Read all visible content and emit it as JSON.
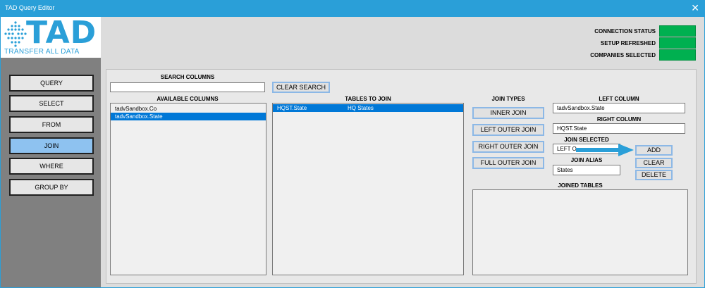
{
  "window": {
    "title": "TAD Query Editor",
    "close_glyph": "✕"
  },
  "logo": {
    "wordmark": "TAD",
    "tagline": "TRANSFER ALL DATA"
  },
  "nav": [
    {
      "label": "QUERY",
      "active": false
    },
    {
      "label": "SELECT",
      "active": false
    },
    {
      "label": "FROM",
      "active": false
    },
    {
      "label": "JOIN",
      "active": true
    },
    {
      "label": "WHERE",
      "active": false
    },
    {
      "label": "GROUP BY",
      "active": false
    }
  ],
  "status": [
    {
      "label": "CONNECTION STATUS",
      "color": "#00b050"
    },
    {
      "label": "SETUP REFRESHED",
      "color": "#00b050"
    },
    {
      "label": "COMPANIES SELECTED",
      "color": "#00b050"
    }
  ],
  "search": {
    "header": "SEARCH COLUMNS",
    "value": "",
    "clear_label": "CLEAR SEARCH"
  },
  "available": {
    "header": "AVAILABLE COLUMNS",
    "items": [
      {
        "label": "tadvSandbox.Co",
        "selected": false
      },
      {
        "label": "tadvSandbox.State",
        "selected": true
      }
    ]
  },
  "tables": {
    "header": "TABLES TO JOIN",
    "items": [
      {
        "table": "HQST.State",
        "alias": "HQ States",
        "selected": true
      }
    ]
  },
  "join_types": {
    "header": "JOIN TYPES",
    "buttons": [
      "INNER JOIN",
      "LEFT OUTER JOIN",
      "RIGHT OUTER JOIN",
      "FULL OUTER JOIN"
    ]
  },
  "left_column": {
    "header": "LEFT COLUMN",
    "value": "tadvSandbox.State"
  },
  "right_column": {
    "header": "RIGHT COLUMN",
    "value": "HQST.State"
  },
  "join_selected": {
    "header": "JOIN SELECTED",
    "value": "LEFT O"
  },
  "join_alias": {
    "header": "JOIN ALIAS",
    "value": "States"
  },
  "actions": {
    "add": "ADD",
    "clear": "CLEAR",
    "delete": "DELETE"
  },
  "joined_tables": {
    "header": "JOINED TABLES",
    "items": []
  },
  "accent": "#2a9fd8",
  "selection_color": "#0078d7",
  "icons": {
    "logo": "network-dots-icon",
    "pointer": "arrow-right-icon"
  }
}
